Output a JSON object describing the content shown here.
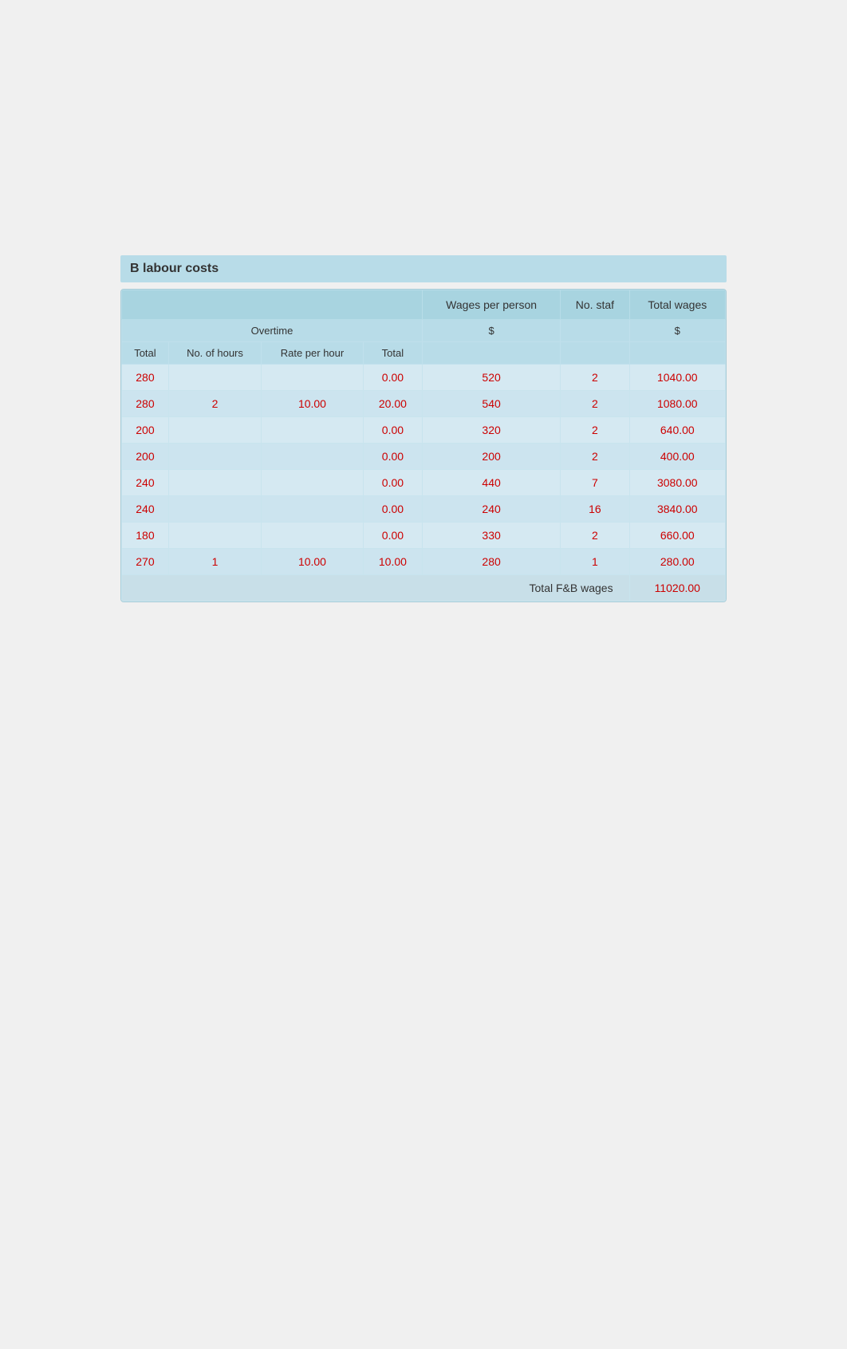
{
  "section": {
    "title": "B labour costs"
  },
  "table": {
    "header1": {
      "cols": [
        {
          "label": "",
          "colspan": 4
        },
        {
          "label": "Wages per person",
          "colspan": 1
        },
        {
          "label": "No. staf",
          "colspan": 1
        },
        {
          "label": "Total wages",
          "colspan": 1
        }
      ]
    },
    "header2": {
      "overtime_label": "Overtime",
      "cols": [
        "Total",
        "No. of hours",
        "Rate per hour",
        "Total",
        "$",
        "",
        "$"
      ]
    },
    "rows": [
      {
        "total": "280",
        "no_hours": "",
        "rate_hour": "",
        "ot_total": "0.00",
        "wages_person": "520",
        "no_staf": "2",
        "total_wages": "1040.00"
      },
      {
        "total": "280",
        "no_hours": "2",
        "rate_hour": "10.00",
        "ot_total": "20.00",
        "wages_person": "540",
        "no_staf": "2",
        "total_wages": "1080.00"
      },
      {
        "total": "200",
        "no_hours": "",
        "rate_hour": "",
        "ot_total": "0.00",
        "wages_person": "320",
        "no_staf": "2",
        "total_wages": "640.00"
      },
      {
        "total": "200",
        "no_hours": "",
        "rate_hour": "",
        "ot_total": "0.00",
        "wages_person": "200",
        "no_staf": "2",
        "total_wages": "400.00"
      },
      {
        "total": "240",
        "no_hours": "",
        "rate_hour": "",
        "ot_total": "0.00",
        "wages_person": "440",
        "no_staf": "7",
        "total_wages": "3080.00"
      },
      {
        "total": "240",
        "no_hours": "",
        "rate_hour": "",
        "ot_total": "0.00",
        "wages_person": "240",
        "no_staf": "16",
        "total_wages": "3840.00"
      },
      {
        "total": "180",
        "no_hours": "",
        "rate_hour": "",
        "ot_total": "0.00",
        "wages_person": "330",
        "no_staf": "2",
        "total_wages": "660.00"
      },
      {
        "total": "270",
        "no_hours": "1",
        "rate_hour": "10.00",
        "ot_total": "10.00",
        "wages_person": "280",
        "no_staf": "1",
        "total_wages": "280.00"
      }
    ],
    "footer": {
      "label": "Total F&B wages",
      "value": "11020.00"
    }
  }
}
